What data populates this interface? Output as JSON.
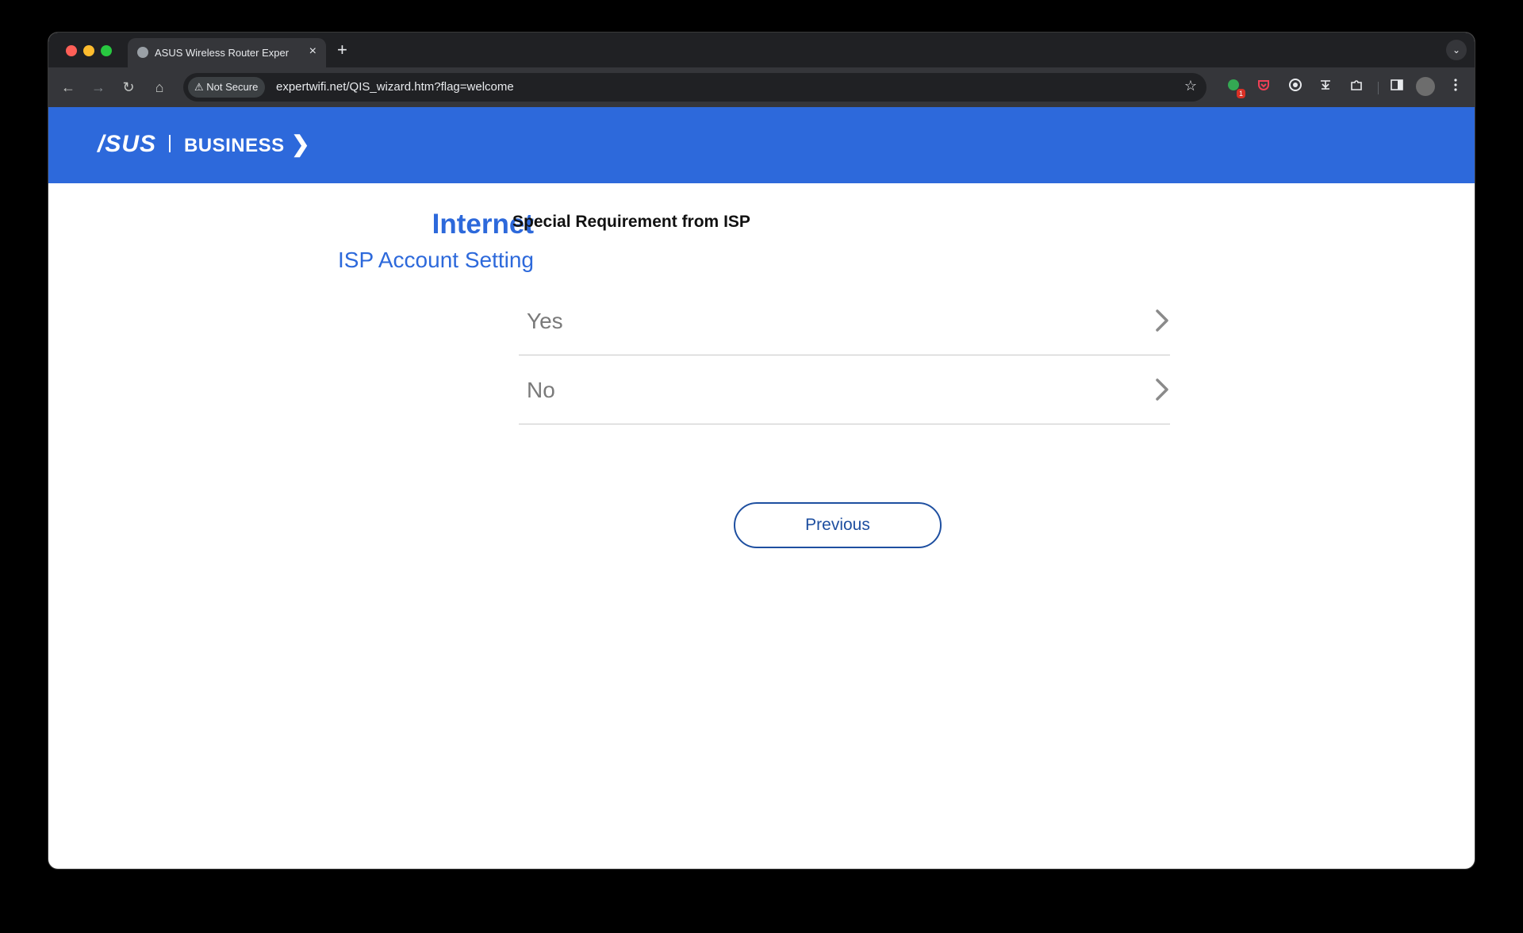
{
  "browser": {
    "tab": {
      "title": "ASUS Wireless Router Exper",
      "close_glyph": "×"
    },
    "new_tab_glyph": "+",
    "tab_menu_glyph": "⌄",
    "nav": {
      "back_glyph": "←",
      "forward_glyph": "→",
      "reload_glyph": "↻",
      "home_glyph": "⌂"
    },
    "omnibox": {
      "security_label": "Not Secure",
      "warning_glyph": "⚠",
      "url": "expertwifi.net/QIS_wizard.htm?flag=welcome",
      "star_glyph": "☆"
    },
    "extensions": {
      "badge_count": "1"
    }
  },
  "header": {
    "logo_asus": "/SUS",
    "logo_business": "BUSINESS",
    "logo_mark": "❯"
  },
  "sidebar": {
    "title": "Internet",
    "subtitle": "ISP Account Setting"
  },
  "main": {
    "section_title": "Special Requirement from ISP",
    "options": [
      {
        "label": "Yes"
      },
      {
        "label": "No"
      }
    ],
    "previous_label": "Previous"
  },
  "colors": {
    "brand_blue": "#2d69db",
    "button_blue": "#1e4fa0"
  }
}
